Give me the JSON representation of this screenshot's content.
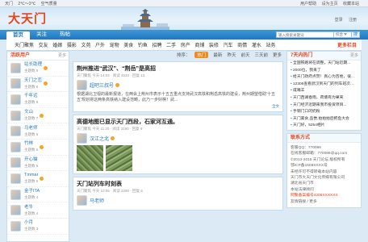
{
  "topbar": {
    "left": [
      "天门",
      "2℃～3℃",
      "空气质量"
    ],
    "right": [
      "用户帮助",
      "设为主页",
      "收藏本站"
    ]
  },
  "banner": {
    "logo": "大天门",
    "links": [
      "登录",
      "注册"
    ]
  },
  "nav1": {
    "tabs": [
      "首页",
      "关注",
      "热帖"
    ],
    "search_placeholder": "输入搜索关键词",
    "search_select": "综合",
    "search_btn": "搜"
  },
  "nav2": {
    "items": [
      "天门聚焦",
      "交友",
      "婚嫁",
      "摄影",
      "文苑",
      "户外",
      "宠物",
      "美食",
      "钓鱼",
      "招聘",
      "二手",
      "房产",
      "商铺",
      "装修",
      "汽车",
      "商情",
      "灌水",
      "站务"
    ],
    "more": "更多栏目"
  },
  "left": {
    "title": "活跃用户",
    "sub": "更多",
    "users": [
      {
        "name": "站长助理",
        "stat": "主题数 9"
      },
      {
        "name": "天门之恋",
        "stat": "主题数 8"
      },
      {
        "name": "千年远",
        "stat": "主题数 8"
      },
      {
        "name": "文山",
        "stat": "主题数 7"
      },
      {
        "name": "马老师",
        "stat": "主题数 6"
      },
      {
        "name": "竹林",
        "stat": "主题数 6"
      },
      {
        "name": "开心猫",
        "stat": "主题数 5"
      },
      {
        "name": "Tmmar",
        "stat": "主题数 5"
      },
      {
        "name": "金子ITA",
        "stat": "主题数 4"
      },
      {
        "name": "老牛",
        "stat": "主题数 4"
      },
      {
        "name": "小月",
        "stat": "主题数 3"
      }
    ]
  },
  "filter": {
    "label": "排序：",
    "items": [
      "热门",
      "最新",
      "昨天",
      "前天",
      "三天前",
      "更多"
    ]
  },
  "posts": [
    {
      "title": "荆州推进“武汉”、“荆岳”是高招",
      "meta": "天门聚焦 今天 14:02 · 阅读 4520 · 回复 13",
      "author": "超吧三叔号",
      "body": "根据湖北卫视的最新报道，在两会上荆州市表示十五五重点支持武汉高铁和荆岳高铁的建设，荆州期望借助'十五五'规划将这两条高铁纳入建设范畴，此乃一步好棋！武...",
      "acts": "全文"
    },
    {
      "title": "高德地图已显示天门西段，石家河互通。",
      "meta": "天门聚焦 今天 11:20 · 阅读 3180 · 回复 9",
      "author": "汉江之北"
    },
    {
      "title": "天门站列车时刻表",
      "meta": "天门聚焦 今天 10:05 · 阅读 2290 · 回复 6",
      "author": "马老师"
    }
  ],
  "right": {
    "hot_title": "7天内热门",
    "hot_more": "更多",
    "hot": [
      "全国铁路将在调整，天门站近期...",
      "2000位，我来了",
      "给天门政府点赞！真心为百姓，很...",
      "12306查看武汉到天门的列车班次...",
      "咸嘴羊",
      "天门西湖春雨，荷塘有为果壳",
      "天门经济近期来我市投资项目...",
      "手钢门口的奶粉",
      "天门美食,品尝,拍拍拍后把鱼大会",
      "天门好，5254相片"
    ],
    "contact_title": "联系方式",
    "contact": [
      "客服QQ：770086",
      "在线客服邮箱：770086@qq.com",
      "©2013-2015 天门论坛 版权所有",
      "鄂ICP备1508XXXX号",
      "未经许可不得转载本站内容",
      "天门市大天门文化传媒有限公司",
      "湖北省天门市",
      "本站法律顾问",
      "网警备案编号4206XXXXXX",
      "友情链接 / 更多"
    ]
  }
}
